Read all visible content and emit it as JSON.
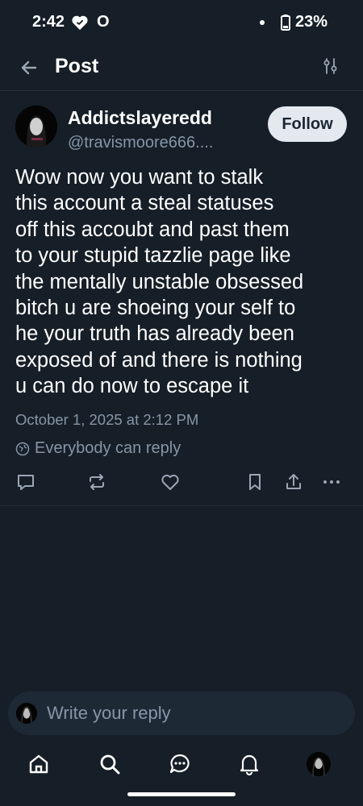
{
  "status_bar": {
    "time": "2:42",
    "carrier_glyph": "O",
    "battery": "23%"
  },
  "header": {
    "title": "Post",
    "back_icon": "arrow-left-icon",
    "filter_icon": "sliders-icon"
  },
  "post": {
    "author_name": "Addictslayeredd",
    "author_handle": "@travismoore666....",
    "follow_label": "Follow",
    "text": "Wow now you want to stalk\nthis account a steal statuses\noff this accoubt and past them\nto your stupid tazzlie page like\nthe mentally unstable obsessed\nbitch u are shoeing your self to\nhe your truth has already been\nexposed of and there is nothing\nu can do now to escape it",
    "timestamp": "October 1, 2025 at 2:12 PM",
    "reply_setting": "Everybody can reply"
  },
  "actions": [
    "reply-icon",
    "repost-icon",
    "like-icon",
    "bookmark-icon",
    "share-icon",
    "more-icon"
  ],
  "reply_bar": {
    "placeholder": "Write your reply"
  },
  "bottom_nav": [
    "home-icon",
    "search-icon",
    "chat-icon",
    "notifications-icon",
    "profile-avatar"
  ],
  "colors": {
    "background": "#161e27",
    "muted_text": "#8696a7",
    "follow_button_bg": "#e4e9ef",
    "divider": "#27313c"
  }
}
